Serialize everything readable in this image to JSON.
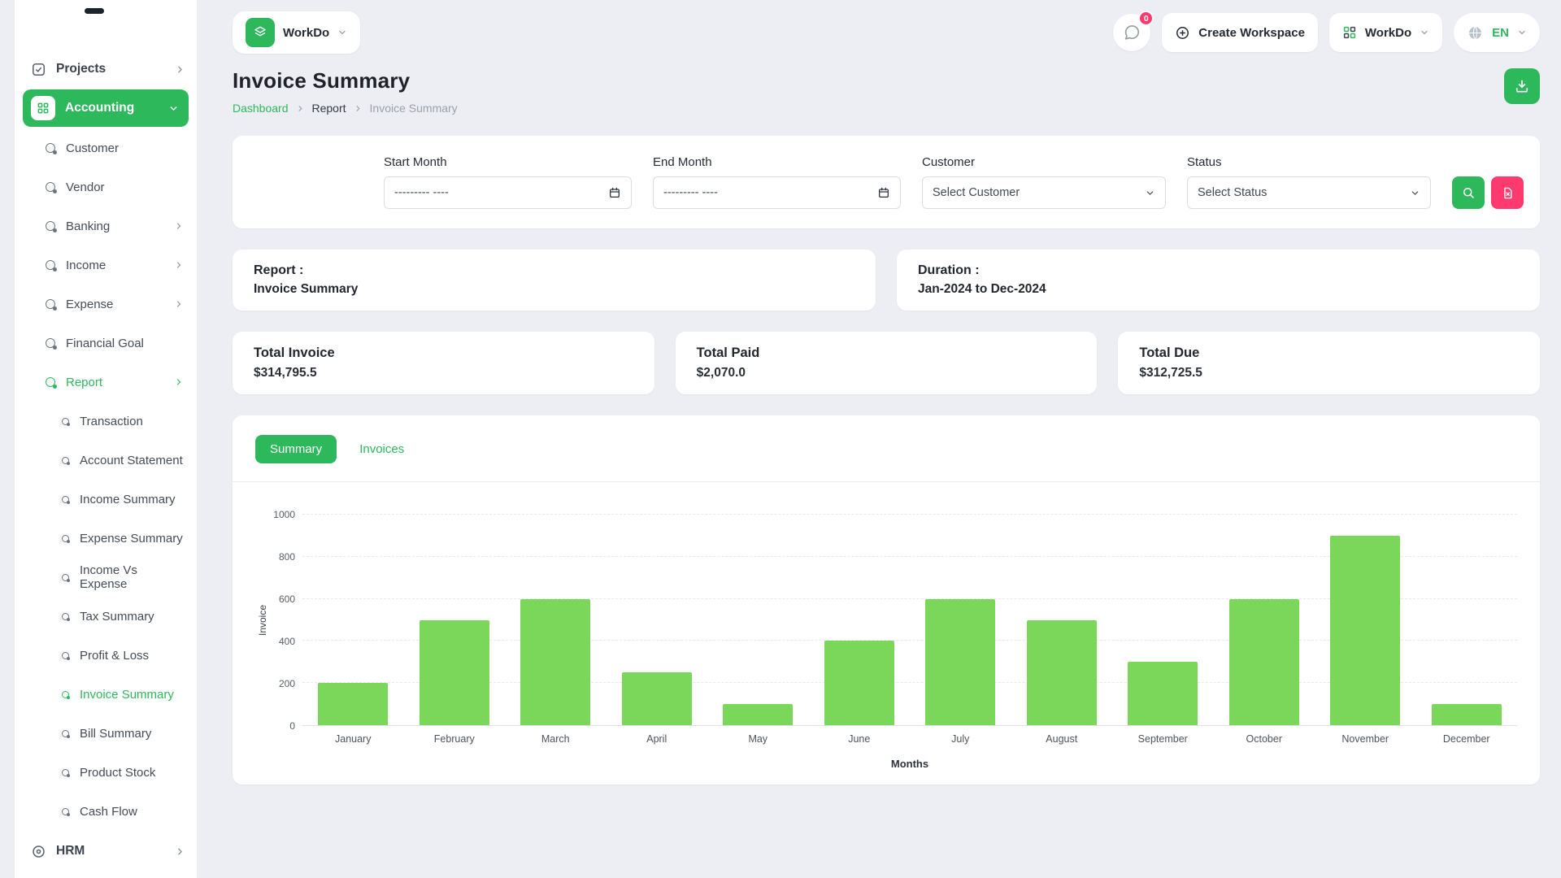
{
  "topbar": {
    "brand": "WorkDo",
    "chat_badge": "0",
    "create_workspace": "Create Workspace",
    "workspace": "WorkDo",
    "language": "EN"
  },
  "sidebar": {
    "projects_label": "Projects",
    "accounting_label": "Accounting",
    "hrm_label": "HRM",
    "accounting_items": [
      {
        "label": "Customer"
      },
      {
        "label": "Vendor"
      },
      {
        "label": "Banking"
      },
      {
        "label": "Income"
      },
      {
        "label": "Expense"
      },
      {
        "label": "Financial Goal"
      },
      {
        "label": "Report"
      }
    ],
    "report_items": [
      {
        "label": "Transaction"
      },
      {
        "label": "Account Statement"
      },
      {
        "label": "Income Summary"
      },
      {
        "label": "Expense Summary"
      },
      {
        "label": "Income Vs Expense"
      },
      {
        "label": "Tax Summary"
      },
      {
        "label": "Profit & Loss"
      },
      {
        "label": "Invoice Summary"
      },
      {
        "label": "Bill Summary"
      },
      {
        "label": "Product Stock"
      },
      {
        "label": "Cash Flow"
      }
    ]
  },
  "page": {
    "title": "Invoice Summary",
    "breadcrumb": {
      "dashboard": "Dashboard",
      "report": "Report",
      "current": "Invoice Summary"
    }
  },
  "filters": {
    "start_month_label": "Start Month",
    "end_month_label": "End Month",
    "customer_label": "Customer",
    "status_label": "Status",
    "date_placeholder": "--------- ----",
    "customer_value": "Select Customer",
    "status_value": "Select Status"
  },
  "report_card": {
    "label": "Report :",
    "value": "Invoice Summary"
  },
  "duration_card": {
    "label": "Duration :",
    "value": "Jan-2024 to Dec-2024"
  },
  "stats": [
    {
      "label": "Total Invoice",
      "value": "$314,795.5"
    },
    {
      "label": "Total Paid",
      "value": "$2,070.0"
    },
    {
      "label": "Total Due",
      "value": "$312,725.5"
    }
  ],
  "tabs": {
    "summary": "Summary",
    "invoices": "Invoices"
  },
  "chart_data": {
    "type": "bar",
    "categories": [
      "January",
      "February",
      "March",
      "April",
      "May",
      "June",
      "July",
      "August",
      "September",
      "October",
      "November",
      "December"
    ],
    "values": [
      200,
      500,
      600,
      250,
      100,
      400,
      600,
      500,
      300,
      600,
      900,
      100
    ],
    "title": "",
    "xlabel": "Months",
    "ylabel": "Invoice",
    "ylim": [
      0,
      1000
    ],
    "yticks": [
      0,
      200,
      400,
      600,
      800,
      1000
    ],
    "grid": "dashed-horizontal",
    "legend": "none",
    "bar_color": "#7bd75a"
  },
  "colors": {
    "accent": "#2eb85c",
    "danger": "#ff3a6e",
    "background": "#eceef3",
    "card": "#ffffff"
  }
}
